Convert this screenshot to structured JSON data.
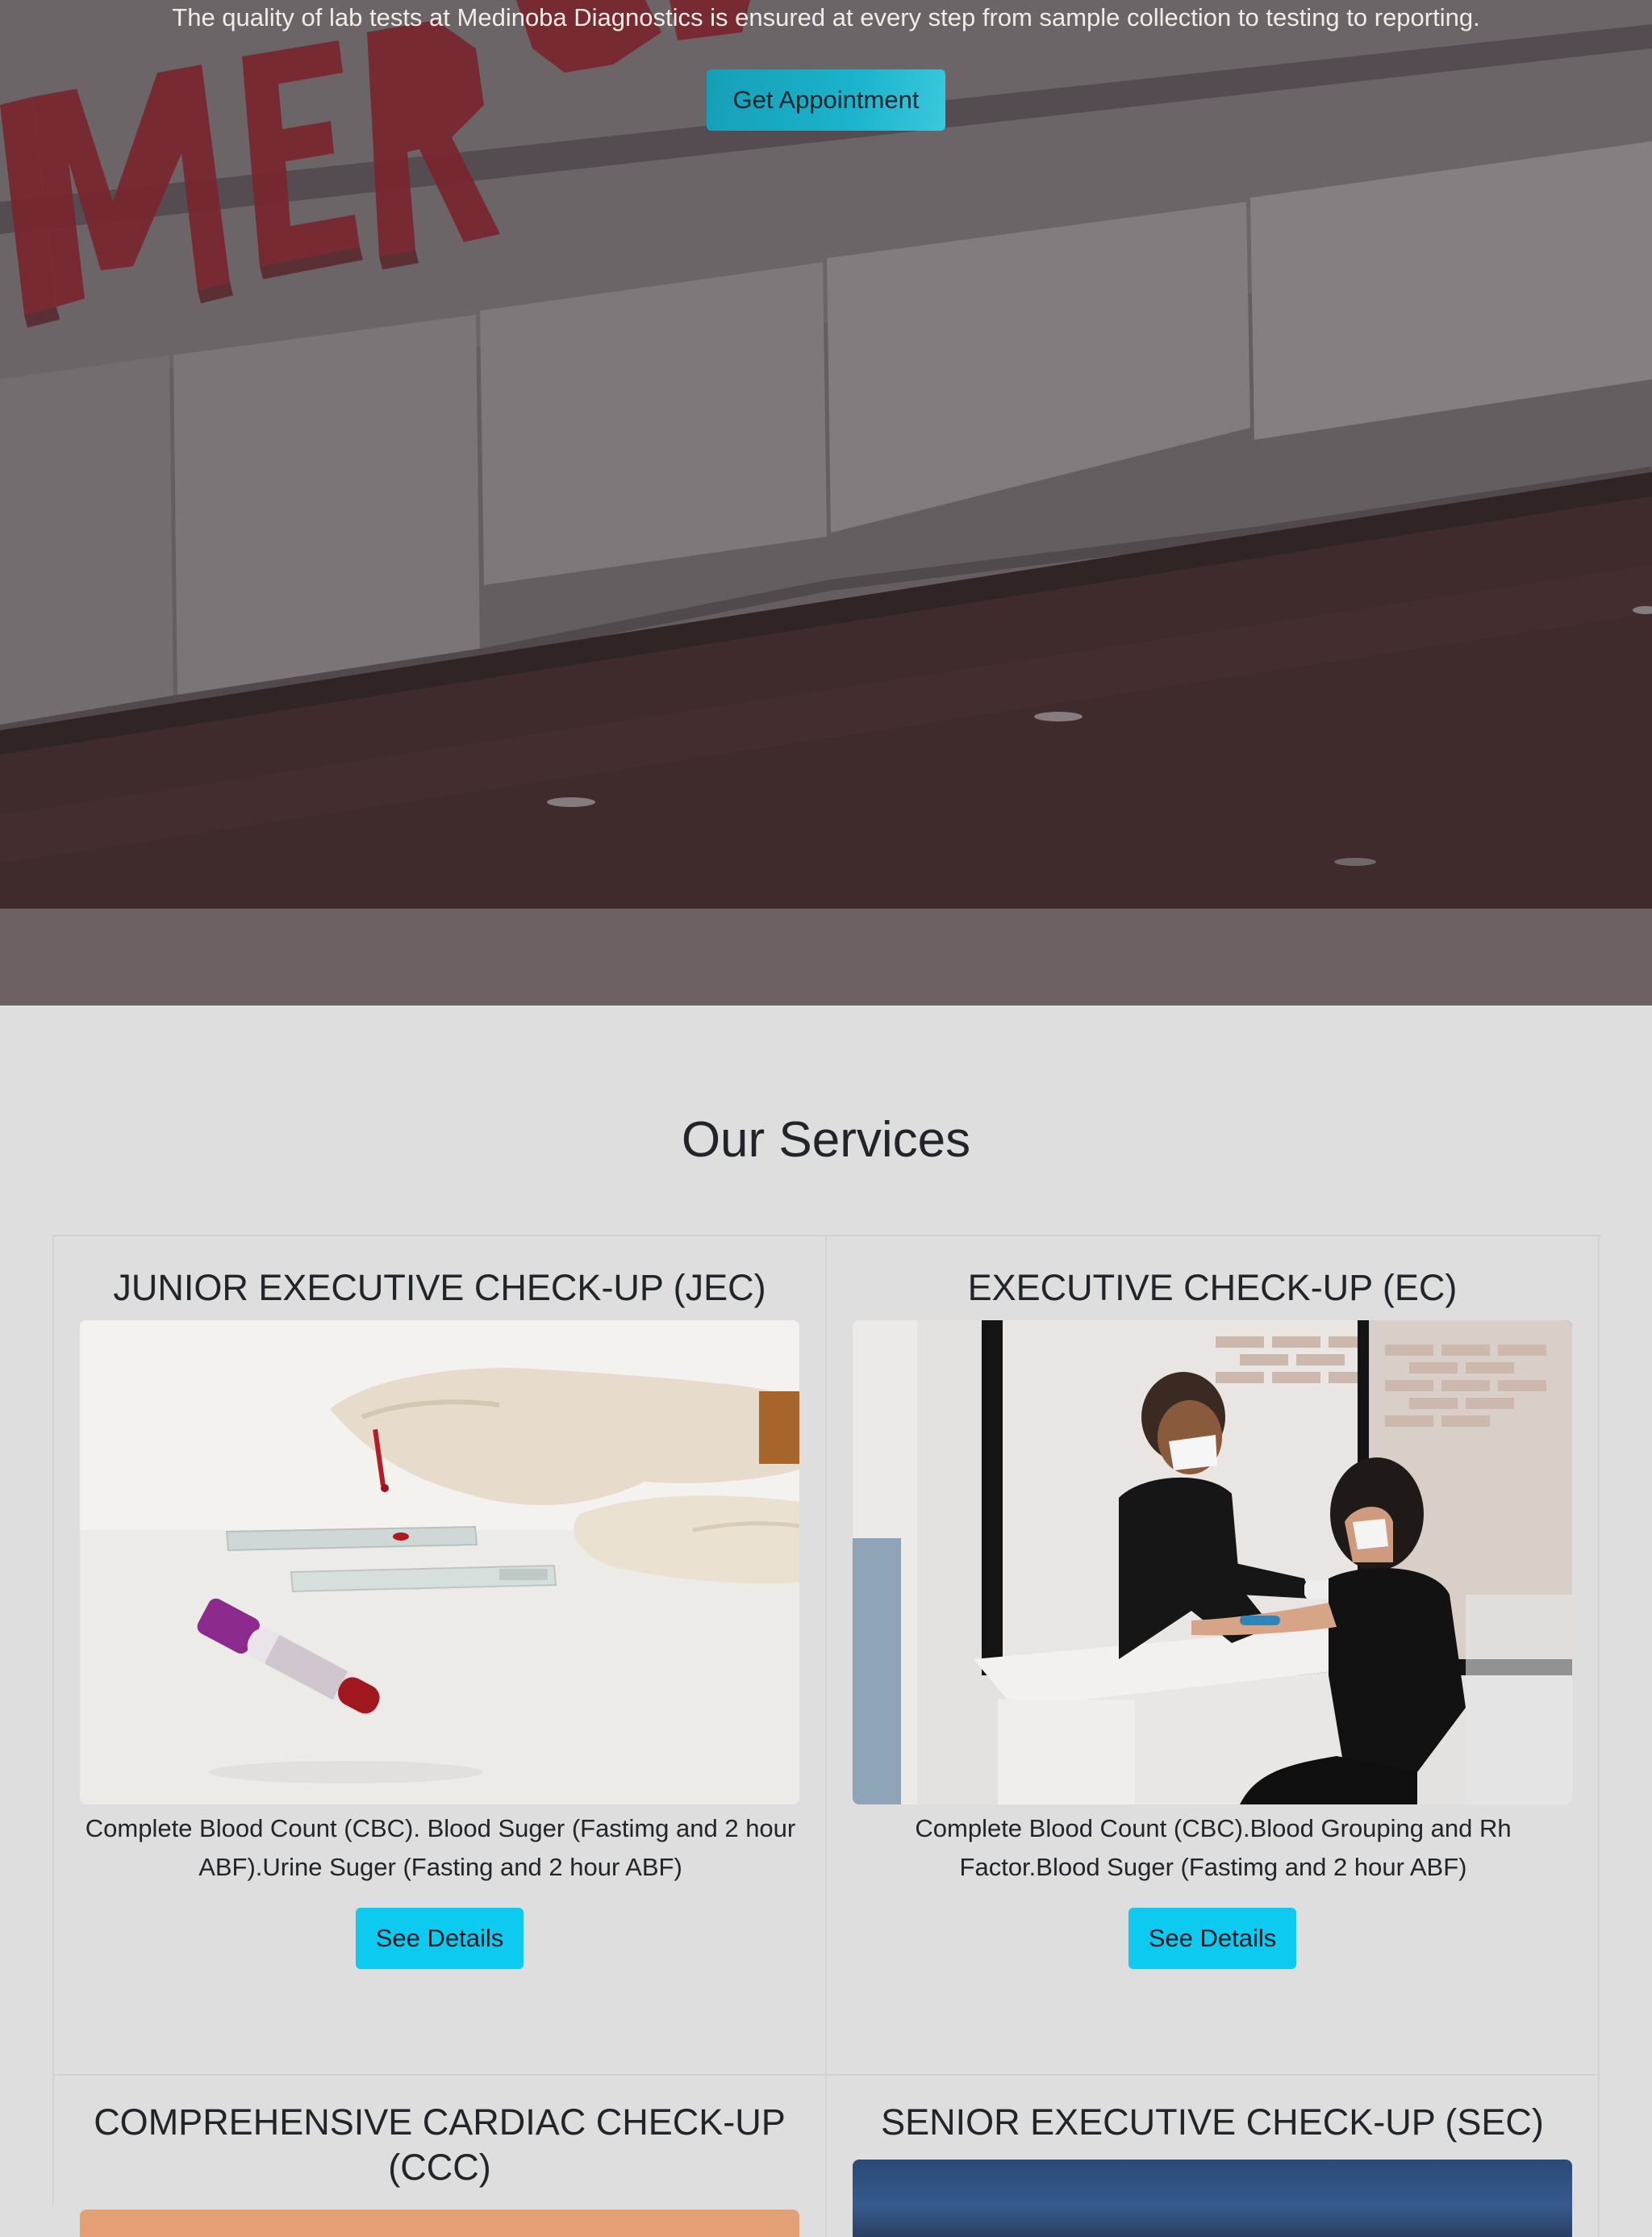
{
  "hero": {
    "tagline": "The quality of lab tests at Medinoba Diagnostics is ensured at every step from sample collection to testing to reporting.",
    "cta_label": "Get Appointment",
    "colors": {
      "overlay": "#6d6164",
      "cta": "#1ab3cb",
      "sign": "#b3232f"
    }
  },
  "services": {
    "heading": "Our Services",
    "accent_color": "#0dcaf0",
    "cards": [
      {
        "title": "JUNIOR EXECUTIVE CHECK-UP (JEC)",
        "image": "blood-sample-tube-photo",
        "description": "Complete Blood Count (CBC). Blood Suger (Fastimg and 2 hour ABF).Urine Suger (Fasting and 2 hour ABF)",
        "button_label": "See Details"
      },
      {
        "title": "EXECUTIVE CHECK-UP (EC)",
        "image": "nurse-drawing-blood-photo",
        "description": "Complete Blood Count (CBC).Blood Grouping and Rh Factor.Blood Suger (Fastimg and 2 hour ABF)",
        "button_label": "See Details"
      },
      {
        "title": "COMPREHENSIVE CARDIAC CHECK-UP (CCC)",
        "image": "cardiac-photo"
      },
      {
        "title": "SENIOR EXECUTIVE CHECK-UP (SEC)",
        "image": "senior-checkup-photo"
      }
    ]
  }
}
